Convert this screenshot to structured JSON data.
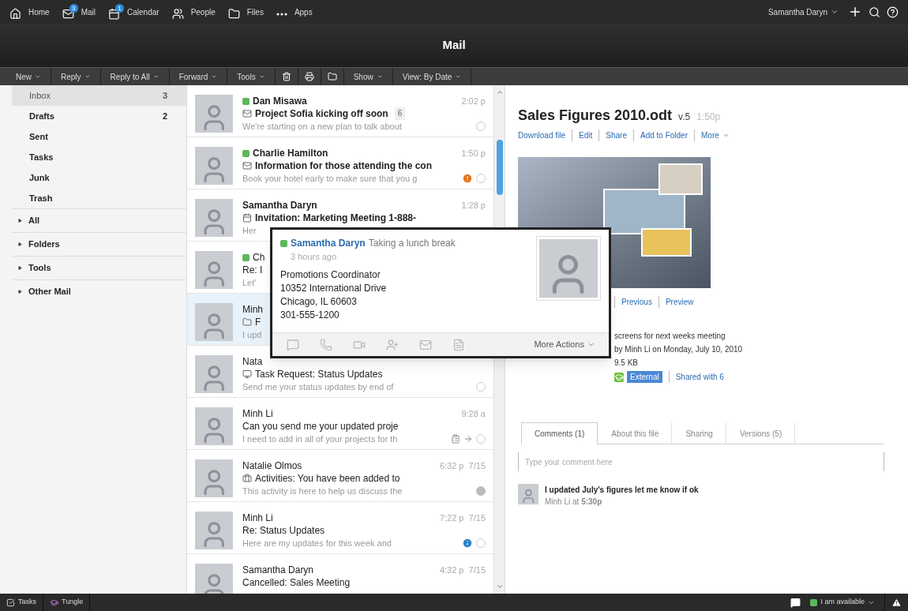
{
  "top_nav": {
    "items": [
      {
        "label": "Home"
      },
      {
        "label": "Mail",
        "badge": "3"
      },
      {
        "label": "Calendar",
        "badge": "1"
      },
      {
        "label": "People"
      },
      {
        "label": "Files"
      },
      {
        "label": "Apps"
      }
    ],
    "user": "Samantha Daryn"
  },
  "window": {
    "title": "Mail"
  },
  "toolbar": [
    {
      "kind": "menu",
      "label": "New"
    },
    {
      "kind": "menu",
      "label": "Reply"
    },
    {
      "kind": "menu",
      "label": "Reply to All"
    },
    {
      "kind": "menu",
      "label": "Forward"
    },
    {
      "kind": "menu",
      "label": "Tools"
    },
    {
      "kind": "icon"
    },
    {
      "kind": "icon"
    },
    {
      "kind": "icon"
    },
    {
      "kind": "menu",
      "label": "Show"
    },
    {
      "kind": "menu",
      "label": "View: By Date"
    }
  ],
  "sidebar": {
    "folders": [
      {
        "label": "Inbox",
        "count": "3",
        "selected": true
      },
      {
        "label": "Drafts",
        "count": "2",
        "selected": false
      },
      {
        "label": "Sent",
        "selected": false
      },
      {
        "label": "Tasks",
        "selected": false
      },
      {
        "label": "Junk",
        "selected": false
      },
      {
        "label": "Trash",
        "selected": false
      }
    ],
    "sections": [
      {
        "label": "All",
        "expanded": false
      },
      {
        "label": "Folders",
        "expanded": false
      },
      {
        "label": "Tools",
        "expanded": false
      },
      {
        "label": "Other Mail",
        "expanded": false
      }
    ]
  },
  "messages": [
    {
      "kind": "mail",
      "sender": "Dan Misawa",
      "online": true,
      "subject": "Project Sofia kicking off soon",
      "thread_count": "6",
      "snippet": "We're starting on a new plan to talk about",
      "time": "2:02 p",
      "unread": true,
      "important": false,
      "info": false,
      "read": false,
      "selected": false
    },
    {
      "kind": "mail",
      "sender": "Charlie Hamilton",
      "online": true,
      "subject": "Information for those attending the con",
      "snippet": "Book your hotel early to make sure that you g",
      "time": "1:50 p",
      "unread": true,
      "important": true,
      "info": false,
      "read": false,
      "selected": false
    },
    {
      "kind": "invitation",
      "sender": "Samantha Daryn",
      "online": false,
      "subject": "Invitation: Marketing Meeting 1-888-",
      "snippet": "Her",
      "time": "1:28 p",
      "unread": true,
      "selected": false
    },
    {
      "kind": "plain",
      "sender": "Ch",
      "online": true,
      "subject": "Re: I",
      "snippet": "Let'",
      "unread": false,
      "selected": false
    },
    {
      "kind": "folder",
      "sender": "Minh",
      "online": false,
      "subject": "F",
      "snippet": "I upd",
      "unread": false,
      "selected": true
    },
    {
      "kind": "task",
      "sender": "Nata",
      "online": false,
      "subject": "Task Request: Status Updates",
      "snippet": "Send me your status updates by end of",
      "unread": false,
      "read": false,
      "selected": false
    },
    {
      "kind": "plain",
      "sender": "Minh Li",
      "online": false,
      "subject": "Can you send me your updated proje",
      "snippet": "I need to add in all of your projects for th",
      "time": "9:28 a",
      "unread": false,
      "forwarded": true,
      "read": false,
      "selected": false
    },
    {
      "kind": "activity",
      "sender": "Natalie Olmos",
      "online": false,
      "subject": "Activities: You have been added to",
      "snippet": "This activity is here to help us discuss the",
      "time": "6:32 p  7/15",
      "unread": false,
      "read": true,
      "selected": false
    },
    {
      "kind": "plain",
      "sender": "Minh Li",
      "online": false,
      "subject": "Re: Status Updates",
      "snippet": "Here are my updates for this week and",
      "time": "7:22 p  7/15",
      "unread": false,
      "important": false,
      "info": true,
      "read": false,
      "selected": false
    },
    {
      "kind": "plain",
      "sender": "Samantha Daryn",
      "online": false,
      "subject": "Cancelled: Sales Meeting",
      "time": "4:32 p  7/15",
      "unread": false,
      "selected": false
    }
  ],
  "business_card": {
    "name": "Samantha Daryn",
    "online": true,
    "status": "Taking a lunch break",
    "status_time": "3 hours ago",
    "lines": [
      "Promotions Coordinator",
      "10352 International Drive",
      "Chicago, IL  60603",
      "301-555-1200"
    ],
    "more": "More Actions"
  },
  "preview": {
    "title": "Sales Figures 2010.odt",
    "version": "v.5",
    "time": "1:50p",
    "actions": [
      {
        "label": "Download file",
        "menu": false
      },
      {
        "label": "Edit",
        "menu": false
      },
      {
        "label": "Share",
        "menu": false
      },
      {
        "label": "Add to Folder",
        "menu": false
      },
      {
        "label": "More",
        "menu": true
      }
    ],
    "nav_links": [
      "Previous",
      "Preview"
    ],
    "details": [
      "screens for next weeks meeting",
      "by Minh Li on Monday, July 10, 2010",
      "9.5 KB"
    ],
    "visibility": "External",
    "shared": "Shared with 6",
    "tabs": [
      {
        "label": "Comments (1)",
        "selected": true
      },
      {
        "label": "About this file",
        "selected": false
      },
      {
        "label": "Sharing",
        "selected": false
      },
      {
        "label": "Versions (5)",
        "selected": false
      }
    ],
    "comment_field": {
      "placeholder": "Type your comment here"
    },
    "comments": [
      {
        "text": "I updated July's figures let me know if ok",
        "byline": "Minh Li at **5:30p**"
      }
    ]
  },
  "status_bar": {
    "left": [
      {
        "label": "Tasks"
      },
      {
        "label": "Tungle"
      }
    ],
    "availability": "I am available",
    "online": true
  }
}
